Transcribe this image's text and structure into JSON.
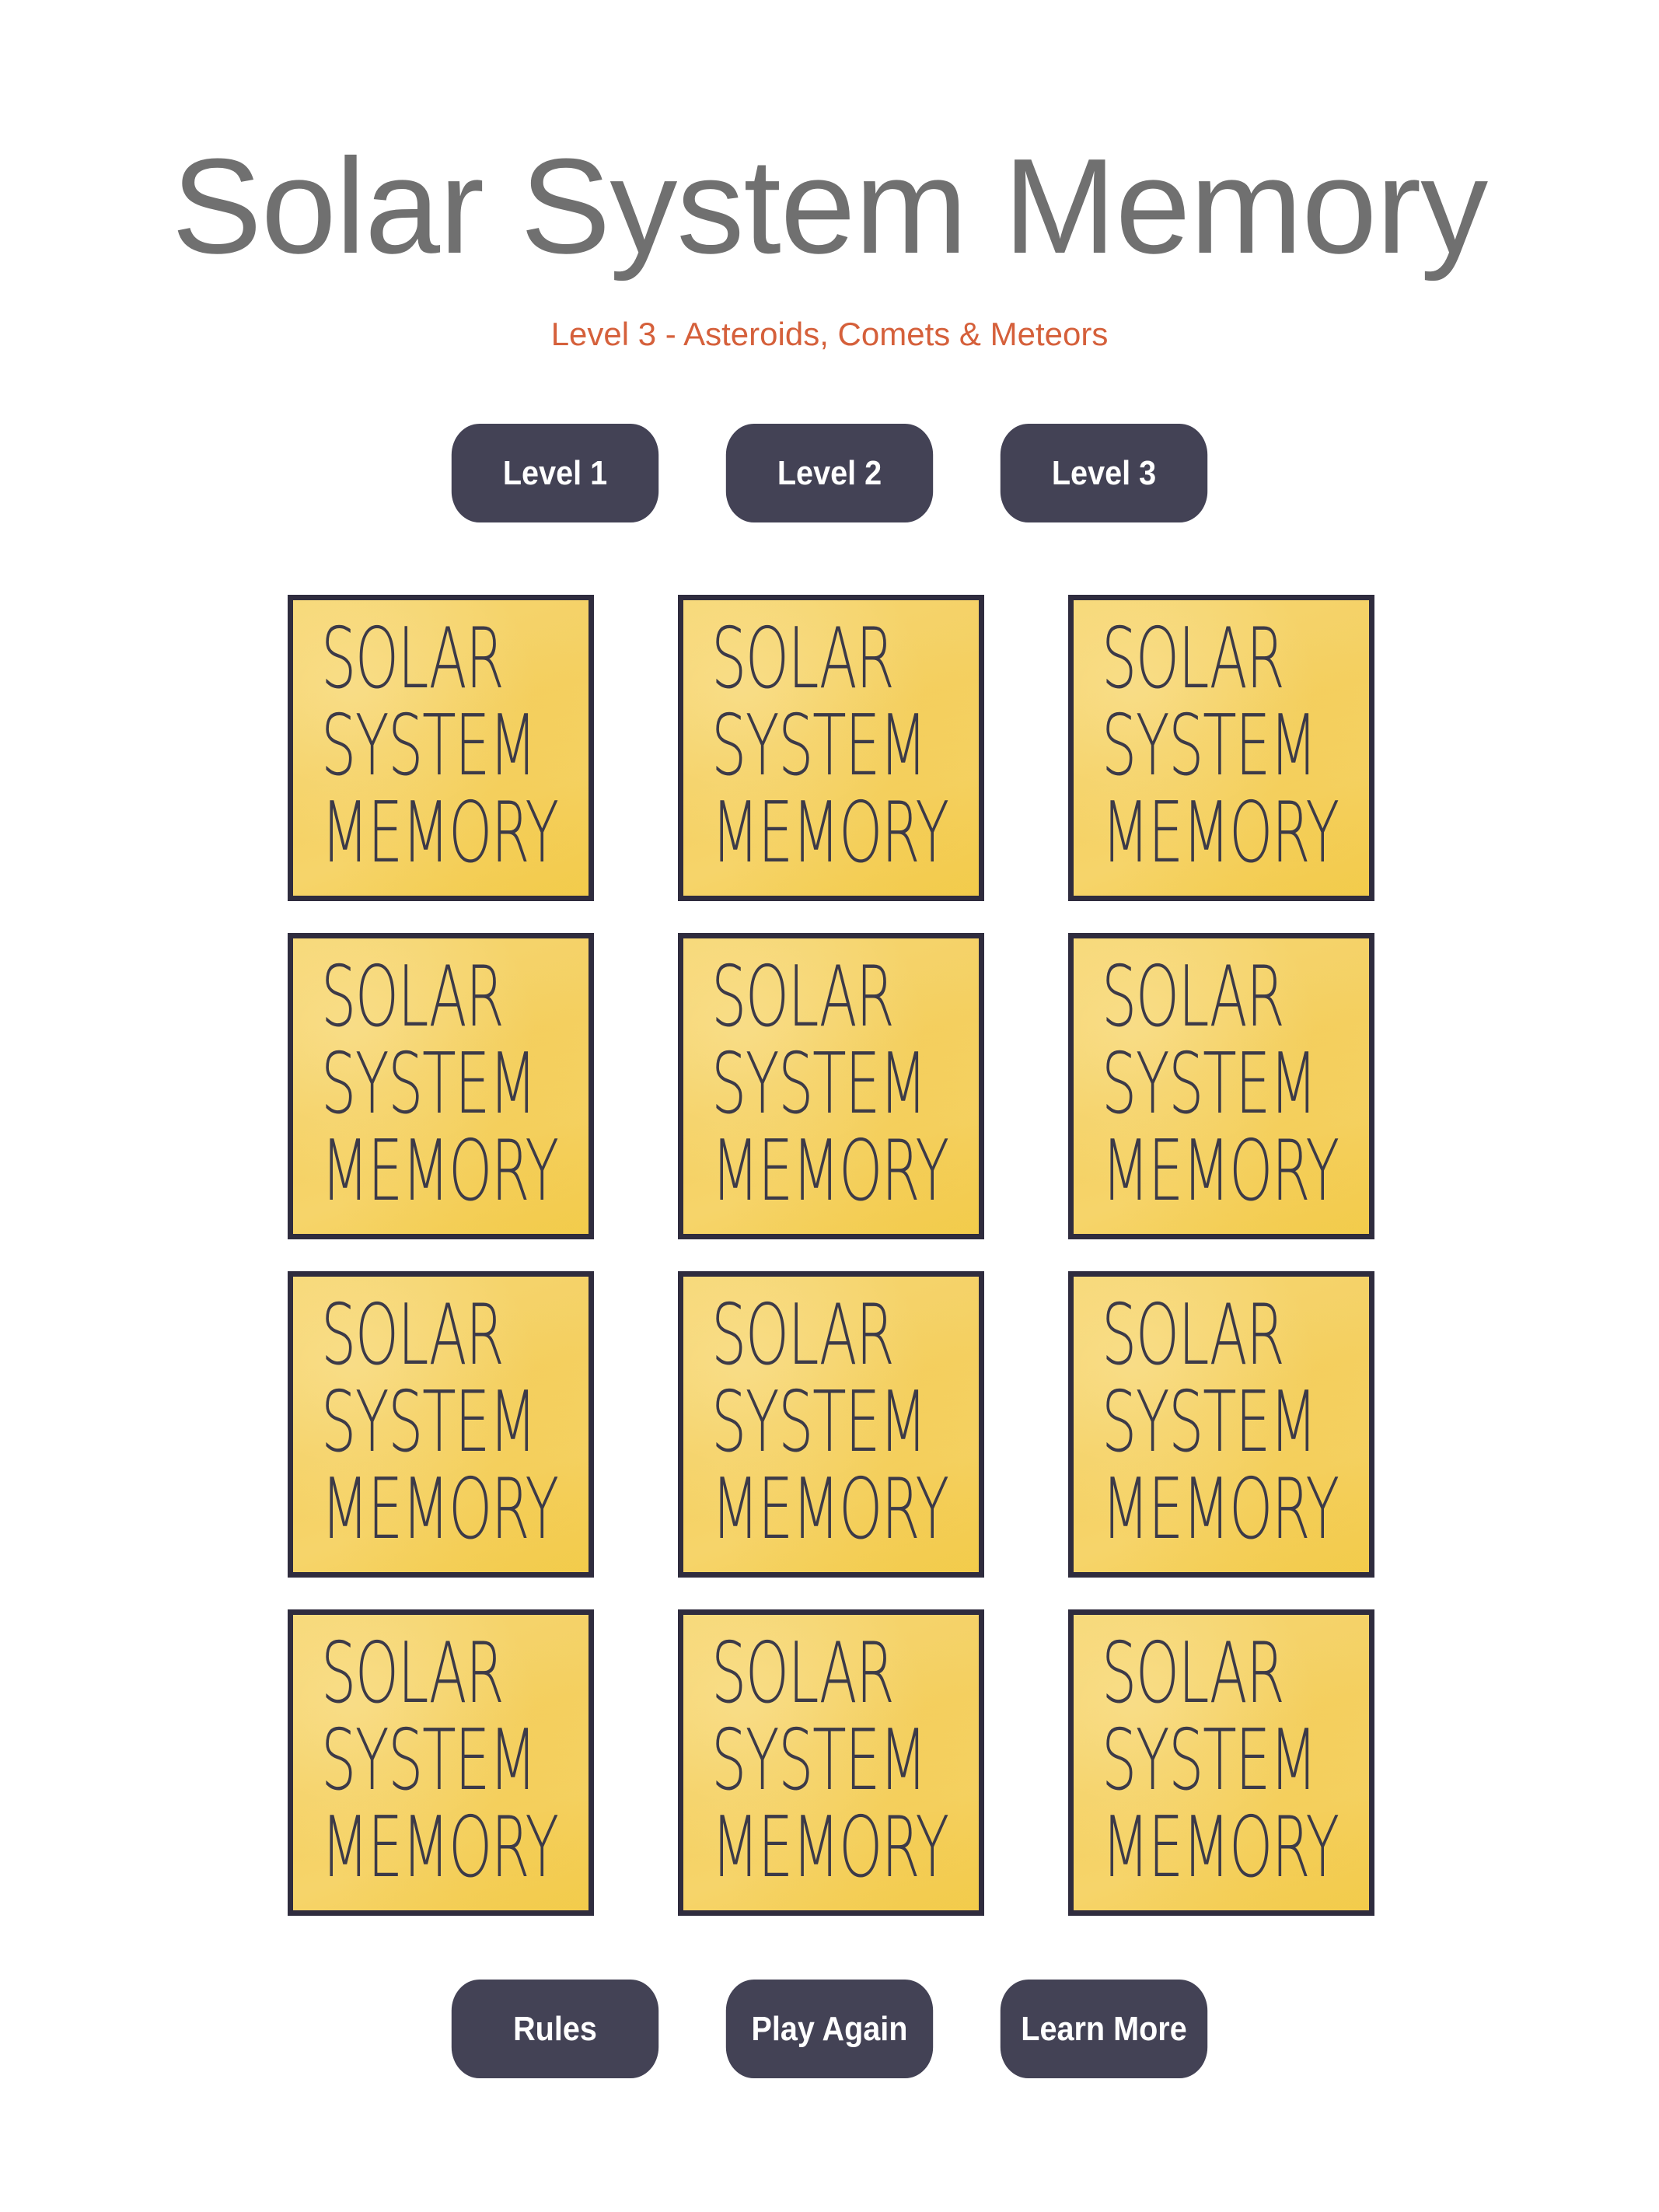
{
  "header": {
    "title": "Solar System Memory",
    "subtitle": "Level 3 - Asteroids, Comets & Meteors"
  },
  "level_buttons": [
    {
      "label": "Level 1"
    },
    {
      "label": "Level 2"
    },
    {
      "label": "Level 3"
    }
  ],
  "card_back": {
    "lines": [
      "SOLAR",
      "SYSTEM",
      "MEMORY"
    ]
  },
  "grid": {
    "rows": 4,
    "columns": 3,
    "card_count": 12
  },
  "action_buttons": [
    {
      "label": "Rules"
    },
    {
      "label": "Play Again"
    },
    {
      "label": "Learn More"
    }
  ],
  "colors": {
    "title": "#707070",
    "subtitle": "#d5603b",
    "button_bg": "#434255",
    "button_text": "#ffffff",
    "card_bg": "#f5d264",
    "card_border": "#2f2c3e",
    "card_text": "#3c3a48"
  }
}
